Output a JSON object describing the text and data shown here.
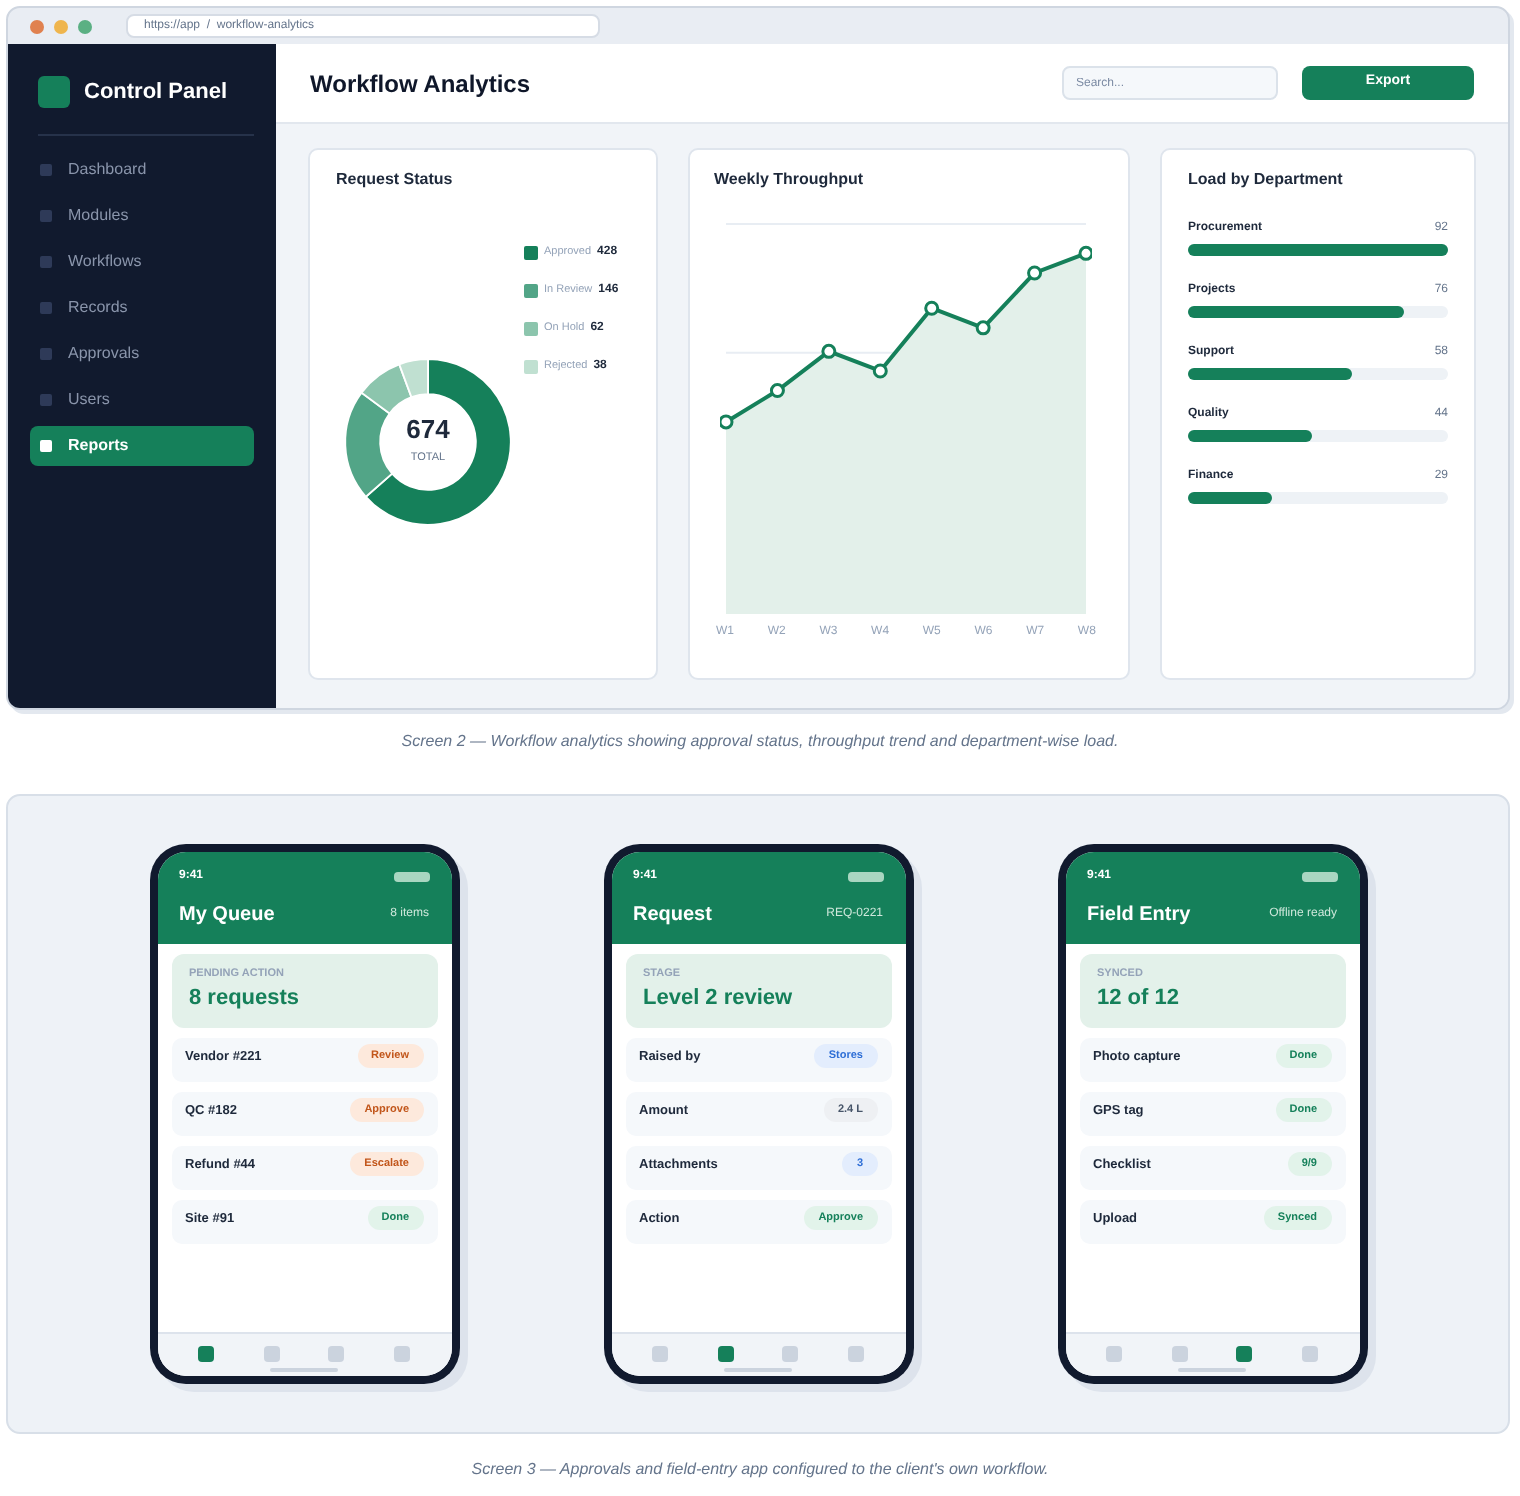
{
  "browser": {
    "url": "https://app  /  workflow-analytics"
  },
  "sidebar": {
    "brand": "Control Panel",
    "items": [
      {
        "label": "Dashboard",
        "selected": false
      },
      {
        "label": "Modules",
        "selected": false
      },
      {
        "label": "Workflows",
        "selected": false
      },
      {
        "label": "Records",
        "selected": false
      },
      {
        "label": "Approvals",
        "selected": false
      },
      {
        "label": "Users",
        "selected": false
      },
      {
        "label": "Reports",
        "selected": true
      }
    ]
  },
  "header": {
    "title": "Workflow Analytics",
    "search": {
      "placeholder": "Search..."
    },
    "button": "Export"
  },
  "request_status": {
    "title": "Request Status",
    "total": "674",
    "total_label": "TOTAL",
    "chart_data": {
      "type": "donut",
      "categories": [
        "Approved",
        "In Review",
        "On Hold",
        "Rejected"
      ],
      "values": [
        63.5,
        21.66,
        9.2,
        5.64
      ],
      "colors": [
        "#15805a",
        "#52a587",
        "#8cc5ad",
        "#c0e0d1"
      ]
    },
    "legend": [
      {
        "value": "428"
      },
      {
        "value": "146"
      },
      {
        "value": "62"
      },
      {
        "value": "38"
      }
    ]
  },
  "throughput": {
    "title": "Weekly Throughput",
    "x_labels": [
      "W1",
      "W2",
      "W3",
      "W4",
      "W5",
      "W6",
      "W7",
      "W8"
    ]
  },
  "departments": {
    "title": "Load by Department",
    "items": [
      {
        "name": "Procurement",
        "value": "92",
        "level": 1.0
      },
      {
        "name": "Projects",
        "value": "76",
        "level": 0.83
      },
      {
        "name": "Support",
        "value": "58",
        "level": 0.63
      },
      {
        "name": "Quality",
        "value": "44",
        "level": 0.48
      },
      {
        "name": "Finance",
        "value": "29",
        "level": 0.32
      }
    ]
  },
  "caption_1": "Screen 2 — Workflow analytics showing approval status, throughput trend and department-wise load.",
  "phones": [
    {
      "time": "9:41",
      "title": "My Queue",
      "meta": "8 items",
      "summary_label": "PENDING ACTION",
      "summary_value": "8 requests",
      "rows": [
        {
          "label": "Vendor #221",
          "badge": "Review",
          "kind": "warning"
        },
        {
          "label": "QC #182",
          "badge": "Approve",
          "kind": "warning"
        },
        {
          "label": "Refund #44",
          "badge": "Escalate",
          "kind": "warning"
        },
        {
          "label": "Site #91",
          "badge": "Done",
          "kind": "success"
        }
      ],
      "tabs": [
        {
          "selected": true
        },
        {
          "selected": false
        },
        {
          "selected": false
        },
        {
          "selected": false
        }
      ]
    },
    {
      "time": "9:41",
      "title": "Request",
      "meta": "REQ-0221",
      "summary_label": "STAGE",
      "summary_value": "Level 2 review",
      "rows": [
        {
          "label": "Raised by",
          "badge": "Stores",
          "kind": "info"
        },
        {
          "label": "Amount",
          "badge": "2.4 L",
          "kind": "neutral"
        },
        {
          "label": "Attachments",
          "badge": "3",
          "kind": "info"
        },
        {
          "label": "Action",
          "badge": "Approve",
          "kind": "success"
        }
      ],
      "tabs": [
        {
          "selected": false
        },
        {
          "selected": true
        },
        {
          "selected": false
        },
        {
          "selected": false
        }
      ]
    },
    {
      "time": "9:41",
      "title": "Field Entry",
      "meta": "Offline ready",
      "summary_label": "SYNCED",
      "summary_value": "12 of 12",
      "rows": [
        {
          "label": "Photo capture",
          "badge": "Done",
          "kind": "success"
        },
        {
          "label": "GPS tag",
          "badge": "Done",
          "kind": "success"
        },
        {
          "label": "Checklist",
          "badge": "9/9",
          "kind": "success"
        },
        {
          "label": "Upload",
          "badge": "Synced",
          "kind": "success"
        }
      ],
      "tabs": [
        {
          "selected": false
        },
        {
          "selected": false
        },
        {
          "selected": true
        },
        {
          "selected": false
        }
      ]
    }
  ],
  "caption_2": "Screen 3 — Approvals and field-entry app configured to the client's own workflow."
}
